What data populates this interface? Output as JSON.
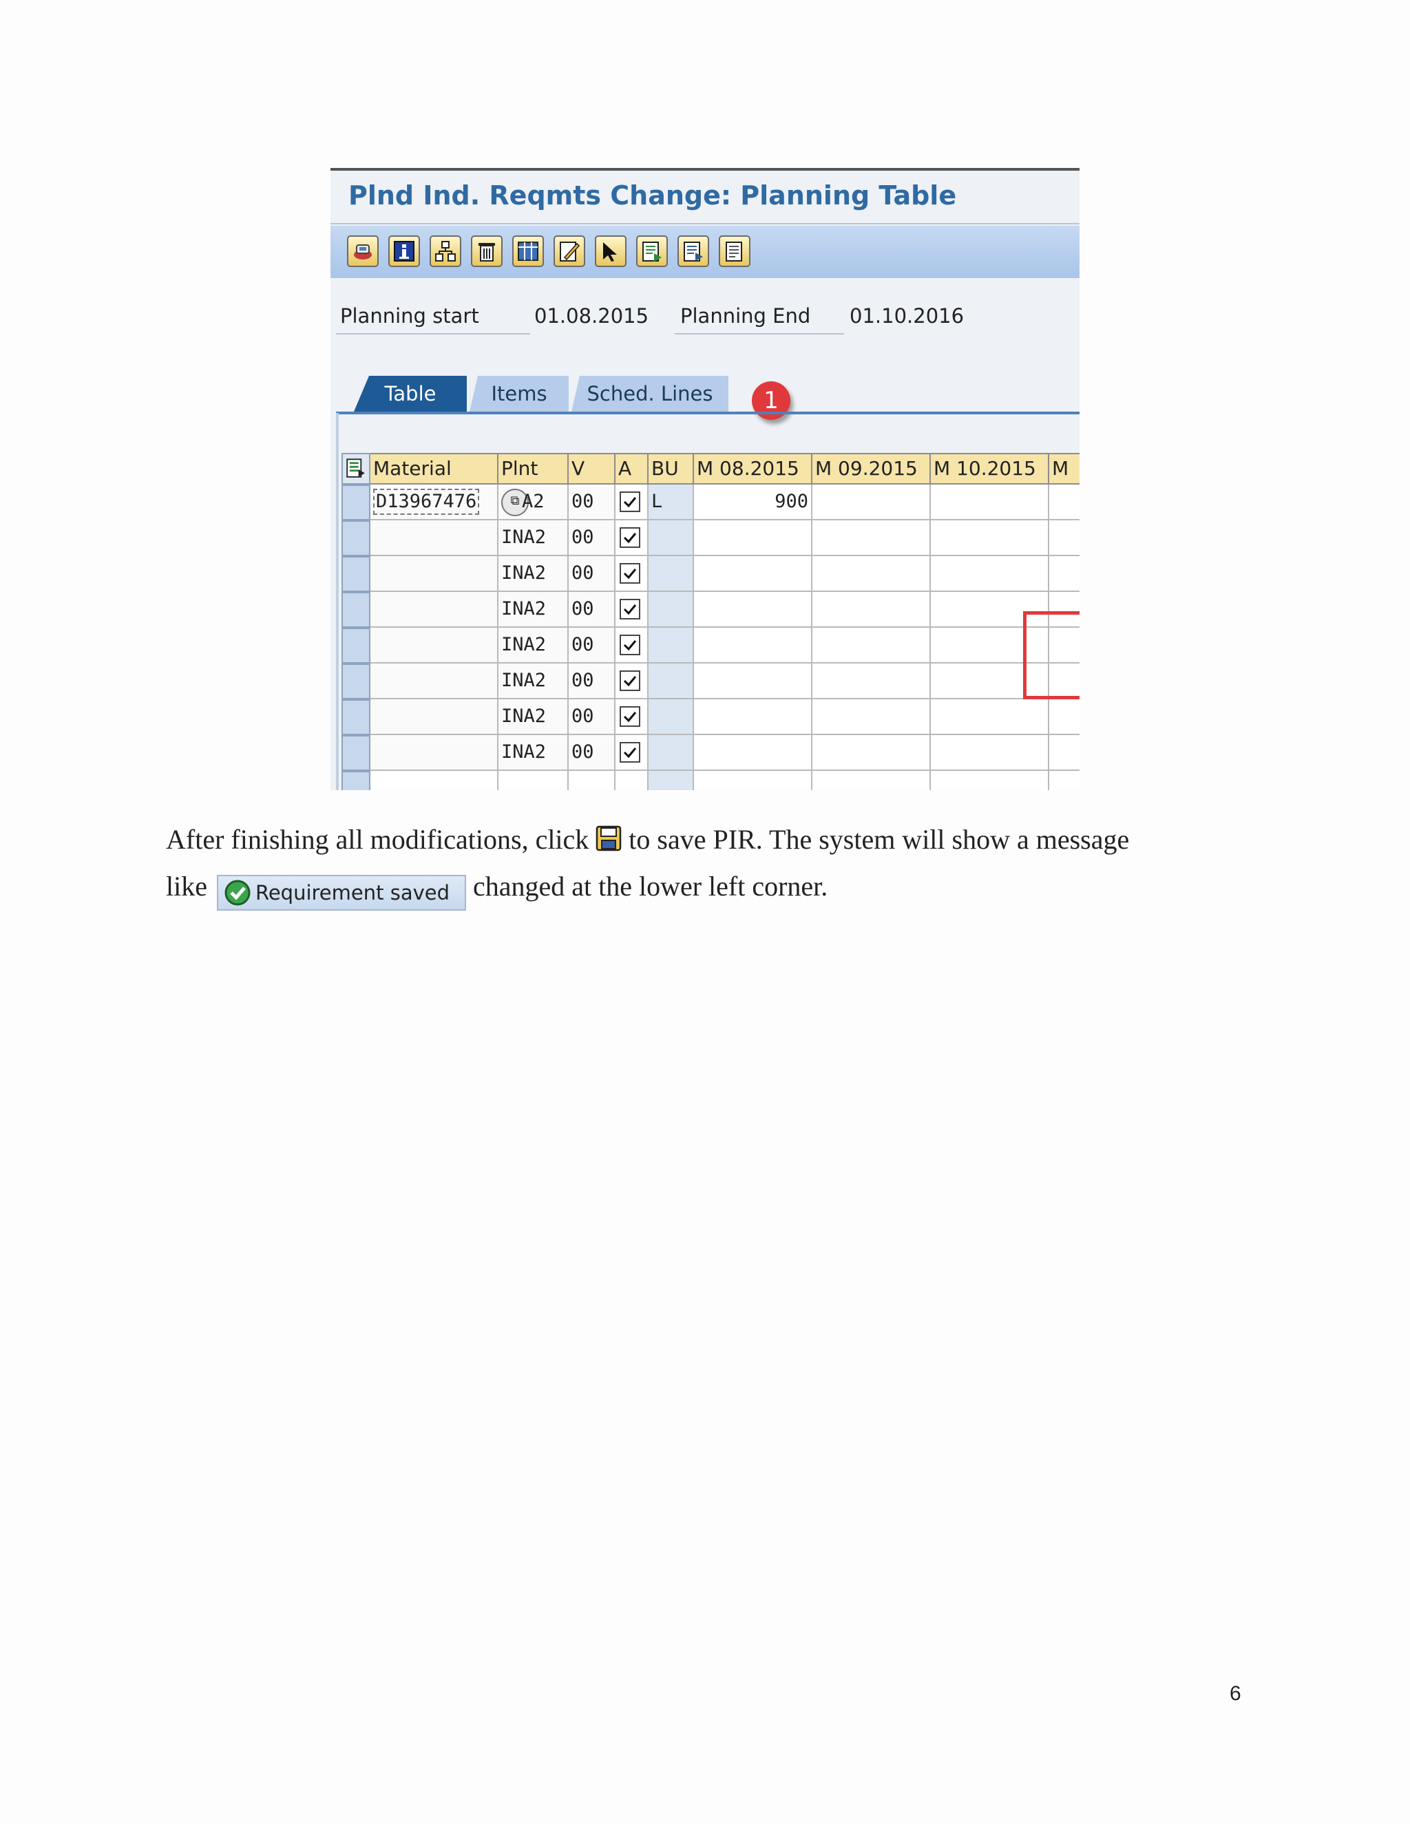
{
  "screenshot": {
    "title": "Plnd Ind. Reqmts Change: Planning Table",
    "toolbar": {
      "buttons": [
        "schedule-icon",
        "info-icon",
        "structure-icon",
        "delete-icon",
        "columns-icon",
        "edit-icon",
        "select-icon",
        "export-icon",
        "forward-icon",
        "document-icon"
      ]
    },
    "planning_start_label": "Planning start",
    "planning_start_value": "01.08.2015",
    "planning_end_label": "Planning End",
    "planning_end_value": "01.10.2016",
    "tabs": [
      {
        "label": "Table",
        "active": true
      },
      {
        "label": "Items",
        "active": false
      },
      {
        "label": "Sched. Lines",
        "active": false
      }
    ],
    "step_badge": "1",
    "grid": {
      "columns": [
        "Material",
        "Plnt",
        "V",
        "A",
        "BU",
        "M 08.2015",
        "M 09.2015",
        "M 10.2015",
        "M"
      ],
      "rows": [
        {
          "material": "D13967476",
          "plant": "A2",
          "version": "00",
          "active": true,
          "bu": "L",
          "m1": "900"
        },
        {
          "material": "",
          "plant": "INA2",
          "version": "00",
          "active": true,
          "bu": "",
          "m1": ""
        },
        {
          "material": "",
          "plant": "INA2",
          "version": "00",
          "active": true,
          "bu": "",
          "m1": ""
        },
        {
          "material": "",
          "plant": "INA2",
          "version": "00",
          "active": true,
          "bu": "",
          "m1": ""
        },
        {
          "material": "",
          "plant": "INA2",
          "version": "00",
          "active": true,
          "bu": "",
          "m1": ""
        },
        {
          "material": "",
          "plant": "INA2",
          "version": "00",
          "active": true,
          "bu": "",
          "m1": ""
        },
        {
          "material": "",
          "plant": "INA2",
          "version": "00",
          "active": true,
          "bu": "",
          "m1": ""
        },
        {
          "material": "",
          "plant": "INA2",
          "version": "00",
          "active": true,
          "bu": "",
          "m1": ""
        }
      ]
    },
    "highlight_color": "#e0393c"
  },
  "body": {
    "line1_before": "After finishing all modifications, click",
    "line1_after": "to save PIR. The system will show a message",
    "line2_before": "like",
    "message_text": "Requirement saved",
    "line2_after": "changed at the lower left corner."
  },
  "page_number": "6"
}
